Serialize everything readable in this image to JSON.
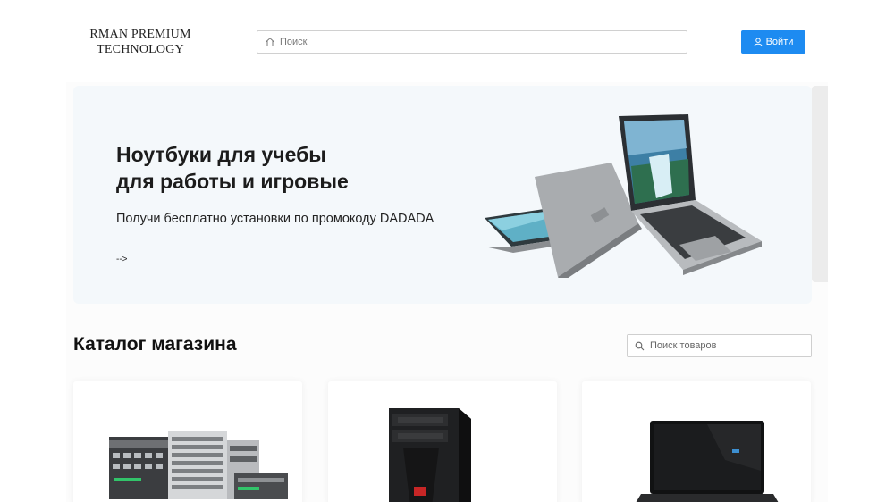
{
  "header": {
    "logo_line1": "RMAN PREMIUM",
    "logo_line2": "TECHNOLOGY",
    "search_placeholder": "Поиск",
    "search_icon": "home-icon",
    "login_label": "Войти",
    "login_icon": "user-icon",
    "accent_color": "#1d8bf1"
  },
  "hero": {
    "title_line1": "Ноутбуки для учебы",
    "title_line2": "для работы и игровые",
    "subtitle": "Получи бесплатно установки по промокоду DADADA",
    "arrow": "-->",
    "image": "laptops-image"
  },
  "catalog": {
    "title": "Каталог магазина",
    "search_placeholder": "Поиск товаров",
    "search_icon": "search-icon",
    "products": [
      {
        "image": "servers-image"
      },
      {
        "image": "pc-tower-image"
      },
      {
        "image": "laptop-image"
      }
    ]
  }
}
